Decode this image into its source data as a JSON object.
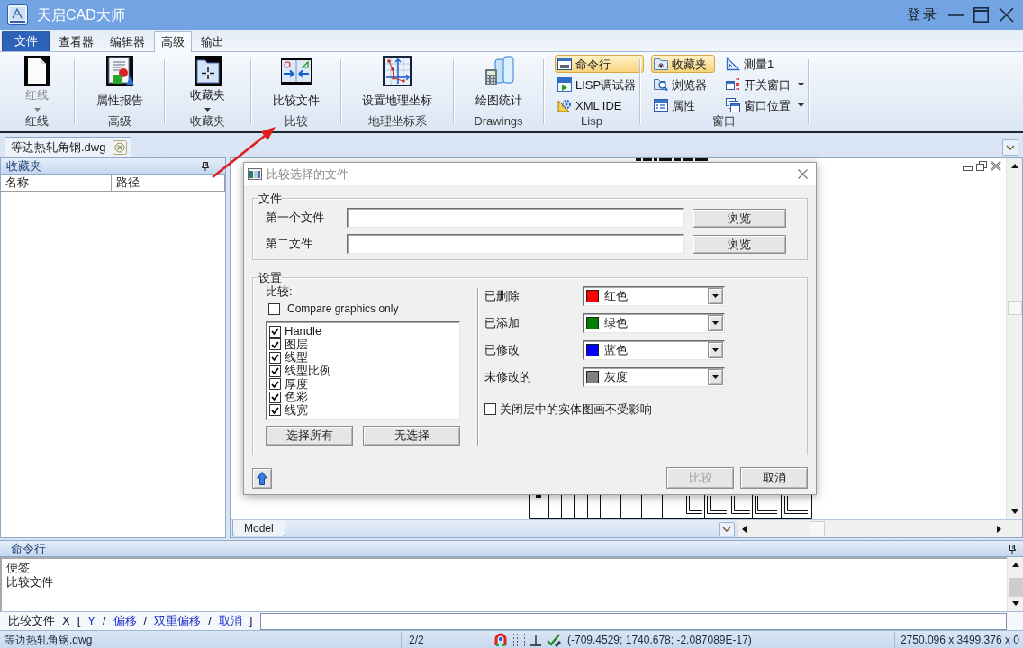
{
  "window": {
    "title": "天启CAD大师",
    "login": "登录"
  },
  "ribbon_tabs": [
    {
      "label": "文件",
      "kind": "menu",
      "selected": false
    },
    {
      "label": "查看器",
      "kind": "tab",
      "selected": false
    },
    {
      "label": "编辑器",
      "kind": "tab",
      "selected": false
    },
    {
      "label": "高级",
      "kind": "tab",
      "selected": true
    },
    {
      "label": "输出",
      "kind": "tab",
      "selected": false
    }
  ],
  "ribbon_groups": [
    {
      "label": "红线",
      "items": [
        {
          "label": "红线",
          "kind": "large",
          "dropdown": true,
          "disabled": true,
          "checked": false
        }
      ]
    },
    {
      "label": "高级",
      "items": [
        {
          "label": "属性报告",
          "kind": "large",
          "dropdown": false,
          "disabled": false,
          "checked": false
        }
      ]
    },
    {
      "label": "收藏夹",
      "items": [
        {
          "label": "收藏夹",
          "kind": "large",
          "dropdown": true,
          "disabled": false,
          "checked": false
        }
      ]
    },
    {
      "label": "比较",
      "items": [
        {
          "label": "比较文件",
          "kind": "large",
          "dropdown": false,
          "disabled": false,
          "checked": false
        }
      ]
    },
    {
      "label": "地理坐标系",
      "items": [
        {
          "label": "设置地理坐标",
          "kind": "large",
          "dropdown": false,
          "disabled": false,
          "checked": false
        }
      ]
    },
    {
      "label": "Drawings",
      "items": [
        {
          "label": "绘图统计",
          "kind": "large",
          "dropdown": false,
          "disabled": false,
          "checked": false
        }
      ]
    },
    {
      "label": "Lisp",
      "items": [
        {
          "label": "命令行",
          "kind": "small",
          "dropdown": false,
          "disabled": false,
          "checked": true
        },
        {
          "label": "LISP调试器",
          "kind": "small",
          "dropdown": false,
          "disabled": false,
          "checked": false
        },
        {
          "label": "XML IDE",
          "kind": "small",
          "dropdown": false,
          "disabled": false,
          "checked": false
        }
      ]
    },
    {
      "label": "窗口",
      "items": [
        {
          "label": "收藏夹",
          "kind": "small",
          "dropdown": false,
          "disabled": false,
          "checked": true
        },
        {
          "label": "浏览器",
          "kind": "small",
          "dropdown": false,
          "disabled": false,
          "checked": false
        },
        {
          "label": "属性",
          "kind": "small",
          "dropdown": false,
          "disabled": false,
          "checked": false
        },
        {
          "label": "测量1",
          "kind": "small",
          "dropdown": false,
          "disabled": false,
          "checked": false
        },
        {
          "label": "开关窗口",
          "kind": "small",
          "dropdown": true,
          "disabled": false,
          "checked": false
        },
        {
          "label": "窗口位置",
          "kind": "small",
          "dropdown": true,
          "disabled": false,
          "checked": false
        }
      ]
    }
  ],
  "document_tabs": [
    {
      "label": "等边热轧角钢.dwg",
      "selected": true
    }
  ],
  "favorites_panel": {
    "title": "收藏夹",
    "columns": [
      "名称",
      "路径"
    ]
  },
  "layout_tabs": [
    {
      "label": "Model",
      "selected": true
    }
  ],
  "dialog": {
    "title": "比较选择的文件",
    "file_group": {
      "title": "文件",
      "rows": [
        {
          "label": "第一个文件",
          "button": "浏览"
        },
        {
          "label": "第二文件",
          "button": "浏览"
        }
      ]
    },
    "settings_group": {
      "title": "设置",
      "compare_label": "比较:",
      "graphics_only": {
        "label": "Compare graphics only",
        "checked": false
      },
      "properties": [
        {
          "label": "Handle",
          "checked": true
        },
        {
          "label": "图层",
          "checked": true
        },
        {
          "label": "线型",
          "checked": true
        },
        {
          "label": "线型比例",
          "checked": true
        },
        {
          "label": "厚度",
          "checked": true
        },
        {
          "label": "色彩",
          "checked": true
        },
        {
          "label": "线宽",
          "checked": true
        }
      ],
      "select_buttons": [
        "选择所有",
        "无选择"
      ],
      "colors": [
        {
          "label": "已删除",
          "value": "红色",
          "color": "#ff0000"
        },
        {
          "label": "已添加",
          "value": "绿色",
          "color": "#008000"
        },
        {
          "label": "已修改",
          "value": "蓝色",
          "color": "#0000ff"
        },
        {
          "label": "未修改的",
          "value": "灰度",
          "color": "#808080"
        }
      ],
      "ignore_off_layers": {
        "label": "关闭层中的实体图画不受影响",
        "checked": false
      }
    },
    "buttons": [
      {
        "label": "比较",
        "disabled": true
      },
      {
        "label": "取消",
        "disabled": false
      }
    ]
  },
  "command_panel": {
    "title": "命令行",
    "history": [
      "便签",
      "比较文件"
    ],
    "prompt": [
      {
        "text": "比较文件",
        "kind": "command"
      },
      {
        "text": "X",
        "kind": "text"
      },
      {
        "text": "[",
        "kind": "text"
      },
      {
        "text": "Y",
        "kind": "option"
      },
      {
        "text": "/",
        "kind": "text"
      },
      {
        "text": "偏移",
        "kind": "option"
      },
      {
        "text": "/",
        "kind": "text"
      },
      {
        "text": "双重偏移",
        "kind": "option"
      },
      {
        "text": "/",
        "kind": "text"
      },
      {
        "text": "取消",
        "kind": "option"
      },
      {
        "text": "]",
        "kind": "text"
      }
    ]
  },
  "status_bar": {
    "file": "等边热轧角钢.dwg",
    "page": "2/2",
    "coordinates": "(-709.4529; 1740.678; -2.087089E-17)",
    "extents": "2750.096 x 3499.376 x 0"
  }
}
